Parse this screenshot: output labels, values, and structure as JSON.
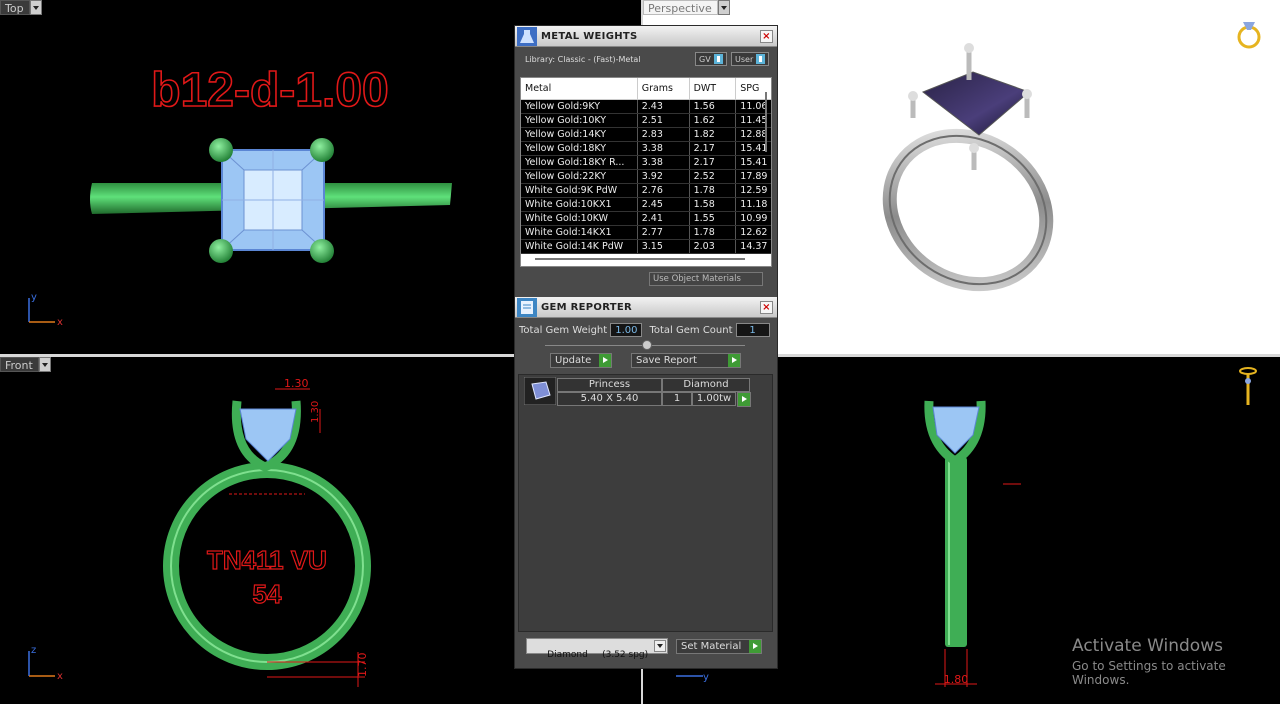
{
  "viewports": {
    "top": {
      "label": "Top",
      "model_text": "b12-d-1.00",
      "axis_x": "x",
      "axis_y": "y"
    },
    "perspective": {
      "label": "Perspective"
    },
    "front": {
      "label": "Front",
      "engrave_line1": "TN411 VU",
      "engrave_line2": "54",
      "dim_top": "1.30",
      "dim_side": "1.30",
      "dim_bottom": "1.70",
      "axis_x": "x",
      "axis_z": "z"
    },
    "right": {
      "dim_bottom": "1.80",
      "axis_y": "y"
    }
  },
  "watermark": {
    "line1": "Activate Windows",
    "line2": "Go to Settings to activate Windows."
  },
  "metal_weights": {
    "title": "METAL WEIGHTS",
    "library": "Library: Classic - (Fast)-Metal",
    "toggle_gv": "GV",
    "toggle_user": "User",
    "columns": [
      "Metal",
      "Grams",
      "DWT",
      "SPG"
    ],
    "rows": [
      [
        "Yellow Gold:9KY",
        "2.43",
        "1.56",
        "11.06"
      ],
      [
        "Yellow Gold:10KY",
        "2.51",
        "1.62",
        "11.45"
      ],
      [
        "Yellow Gold:14KY",
        "2.83",
        "1.82",
        "12.88"
      ],
      [
        "Yellow Gold:18KY",
        "3.38",
        "2.17",
        "15.41"
      ],
      [
        "Yellow Gold:18KY R...",
        "3.38",
        "2.17",
        "15.41"
      ],
      [
        "Yellow Gold:22KY",
        "3.92",
        "2.52",
        "17.89"
      ],
      [
        "White Gold:9K PdW",
        "2.76",
        "1.78",
        "12.59"
      ],
      [
        "White Gold:10KX1",
        "2.45",
        "1.58",
        "11.18"
      ],
      [
        "White Gold:10KW",
        "2.41",
        "1.55",
        "10.99"
      ],
      [
        "White Gold:14KX1",
        "2.77",
        "1.78",
        "12.62"
      ],
      [
        "White Gold:14K PdW",
        "3.15",
        "2.03",
        "14.37"
      ]
    ],
    "use_object_materials": "Use Object Materials"
  },
  "gem_reporter": {
    "title": "GEM REPORTER",
    "total_weight_label": "Total Gem Weight",
    "total_weight_value": "1.00",
    "total_count_label": "Total Gem Count",
    "total_count_value": "1",
    "update_label": "Update",
    "save_report_label": "Save Report",
    "gem": {
      "shape": "Princess",
      "material": "Diamond",
      "size": "5.40 X 5.40",
      "count": "1",
      "weight": "1.00tw"
    },
    "material_select": "Diamond     (3.52 spg)",
    "set_material_label": "Set Material"
  }
}
